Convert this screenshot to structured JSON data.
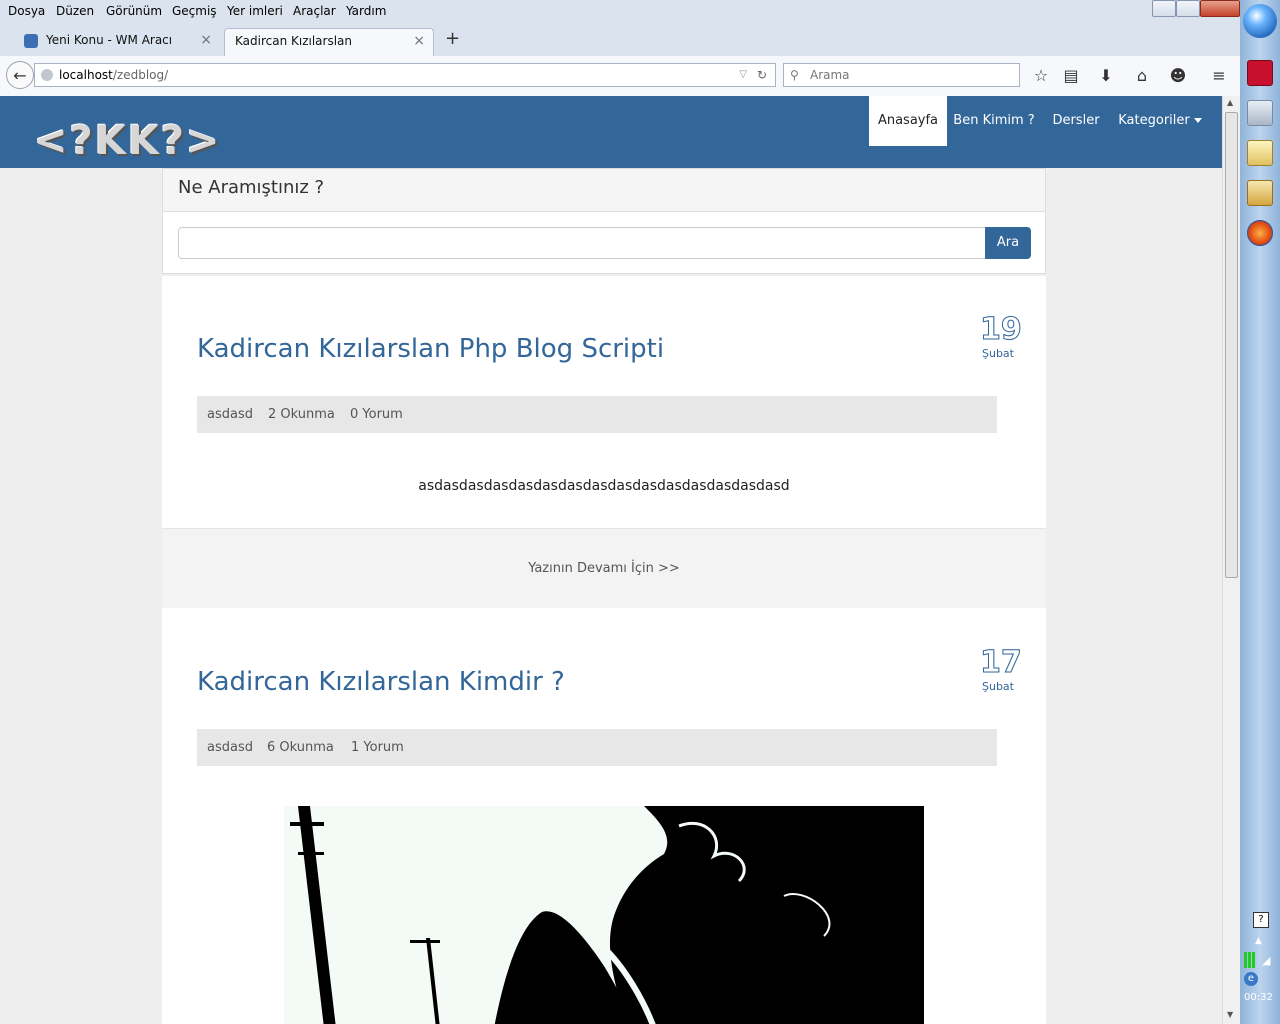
{
  "menubar": {
    "items": [
      "Dosya",
      "Düzen",
      "Görünüm",
      "Geçmiş",
      "Yer imleri",
      "Araçlar",
      "Yardım"
    ]
  },
  "tabs": [
    {
      "label": "Yeni Konu - WM Aracı",
      "close": "×"
    },
    {
      "label": "Kadircan Kızılarslan",
      "close": "×"
    }
  ],
  "newtab": "+",
  "navbar": {
    "back": "←",
    "url_host": "localhost",
    "url_path": "/zedblog/",
    "search_placeholder": "Arama"
  },
  "site": {
    "logo": "<?KK?>",
    "nav": [
      {
        "label": "Anasayfa",
        "active": true
      },
      {
        "label": "Ben Kimim ?"
      },
      {
        "label": "Dersler"
      },
      {
        "label": "Kategoriler"
      }
    ],
    "search": {
      "heading": "Ne Aramıştınız ?",
      "button": "Ara",
      "value": ""
    },
    "posts": [
      {
        "title": "Kadircan Kızılarslan Php Blog Scripti",
        "day": "19",
        "month": "Şubat",
        "author": "asdasd",
        "reads": "2 Okunma",
        "comments": "0 Yorum",
        "excerpt": "asdasdasdasdasdasdasdasdasdasdasdasdasdasdasd",
        "more": "Yazının Devamı İçin >>"
      },
      {
        "title": "Kadircan Kızılarslan Kimdir ?",
        "day": "17",
        "month": "Şubat",
        "author": "asdasd",
        "reads": "6 Okunma",
        "comments": "1 Yorum"
      }
    ]
  },
  "taskbar": {
    "clock": "00:32"
  },
  "colors": {
    "header": "#336699",
    "accent": "#336699",
    "chrome": "#dbe3ee"
  }
}
